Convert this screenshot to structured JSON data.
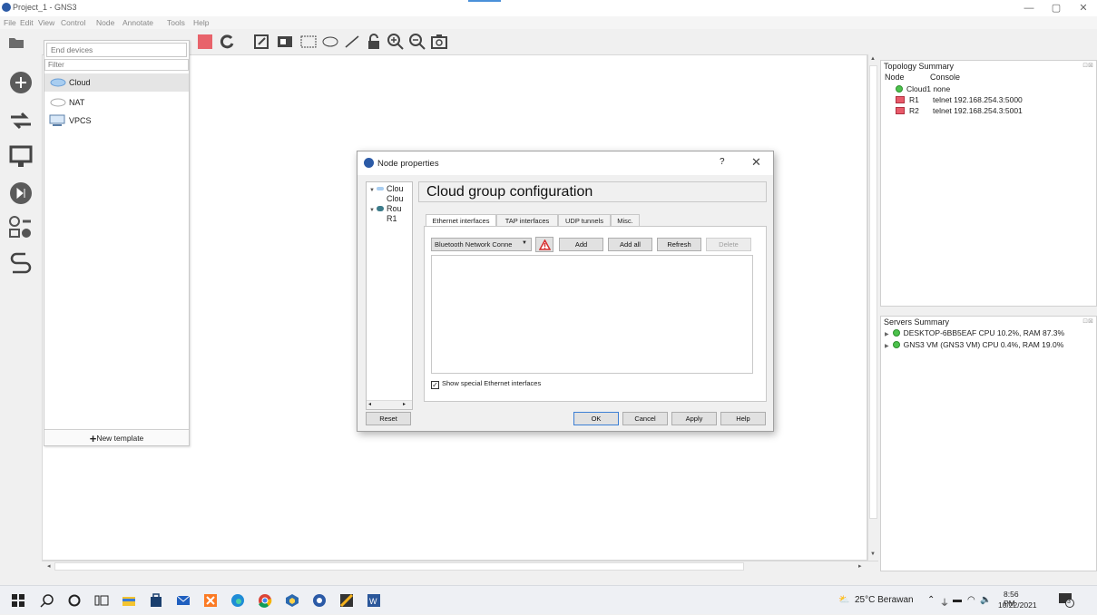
{
  "window": {
    "title": "Project_1 - GNS3",
    "controls": {
      "minimize": "—",
      "maximize": "▢",
      "close": "✕"
    }
  },
  "menubar": [
    "File",
    "Edit",
    "View",
    "Control",
    "Node",
    "Annotate",
    "Tools",
    "Help"
  ],
  "toolbar": {
    "icons": [
      "open-folder-icon",
      "stop-icon",
      "reload-icon",
      "edit-note-icon",
      "image-icon",
      "rectangle-icon",
      "ellipse-icon",
      "line-icon",
      "lock-icon",
      "zoom-in-icon",
      "zoom-out-icon",
      "screenshot-icon"
    ]
  },
  "left_dock": [
    "routers-icon",
    "switches-icon",
    "end-devices-icon",
    "security-devices-icon",
    "all-devices-icon",
    "add-link-icon"
  ],
  "devices_panel": {
    "category": "End devices",
    "filter_placeholder": "Filter",
    "items": [
      {
        "label": "Cloud",
        "icon": "cloud-icon",
        "selected": true
      },
      {
        "label": "NAT",
        "icon": "nat-cloud-icon",
        "selected": false
      },
      {
        "label": "VPCS",
        "icon": "vpcs-monitor-icon",
        "selected": false
      }
    ],
    "new_template": "New template"
  },
  "topology_summary": {
    "title": "Topology Summary",
    "columns": [
      "Node",
      "Console"
    ],
    "rows": [
      {
        "node": "Cloud1",
        "console": "none",
        "type": "cloud"
      },
      {
        "node": "R1",
        "console": "telnet 192.168.254.3:5000",
        "type": "router"
      },
      {
        "node": "R2",
        "console": "telnet 192.168.254.3:5001",
        "type": "router"
      }
    ]
  },
  "servers_summary": {
    "title": "Servers Summary",
    "rows": [
      {
        "text": "DESKTOP-6BB5EAF CPU 10.2%, RAM 87.3%"
      },
      {
        "text": "GNS3 VM (GNS3 VM) CPU 0.4%, RAM 19.0%"
      }
    ]
  },
  "dialog": {
    "title": "Node properties",
    "help": "?",
    "close": "✕",
    "tree": [
      {
        "label": "Clou",
        "level": 0
      },
      {
        "label": "Clou",
        "level": 1
      },
      {
        "label": "Rou",
        "level": 0
      },
      {
        "label": "R1",
        "level": 1
      }
    ],
    "heading": "Cloud group configuration",
    "tabs": [
      "Ethernet interfaces",
      "TAP interfaces",
      "UDP tunnels",
      "Misc."
    ],
    "active_tab": 0,
    "interface_select": "Bluetooth Network Conne",
    "buttons": {
      "add": "Add",
      "add_all": "Add all",
      "refresh": "Refresh",
      "delete": "Delete"
    },
    "show_special": {
      "label": "Show special Ethernet interfaces",
      "checked": true
    },
    "reset": "Reset",
    "ok": "OK",
    "cancel": "Cancel",
    "apply": "Apply",
    "help_btn": "Help"
  },
  "taskbar": {
    "weather": "25°C Berawan",
    "time": "8:56 PM",
    "date": "10/22/2021",
    "notifications": "3"
  }
}
